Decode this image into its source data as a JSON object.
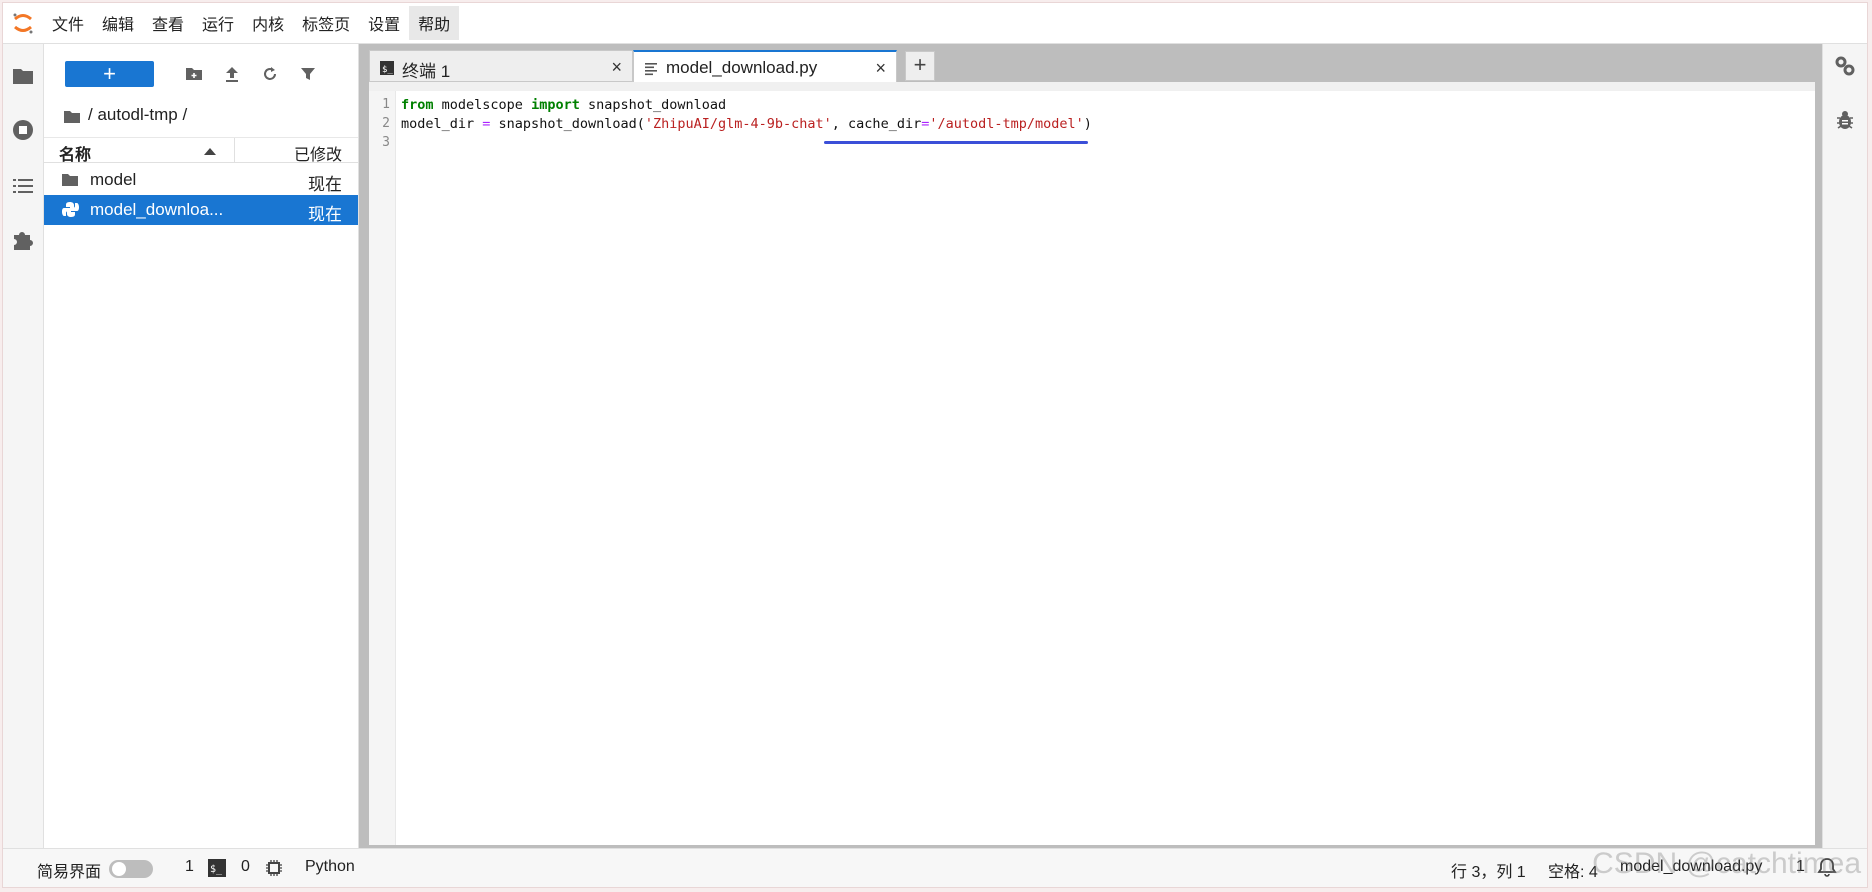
{
  "menubar": {
    "items": [
      "文件",
      "编辑",
      "查看",
      "运行",
      "内核",
      "标签页",
      "设置",
      "帮助"
    ],
    "active_index": 7
  },
  "filebrowser": {
    "new_label": "+",
    "breadcrumb": "/ autodl-tmp /",
    "col_name": "名称",
    "col_modified": "已修改",
    "items": [
      {
        "name": "model",
        "modified": "现在",
        "type": "folder"
      },
      {
        "name": "model_downloa...",
        "modified": "现在",
        "type": "python"
      }
    ]
  },
  "tabs": [
    {
      "label": "终端 1",
      "close": "×",
      "active": false
    },
    {
      "label": "model_download.py",
      "close": "×",
      "active": true
    }
  ],
  "add_tab_label": "+",
  "editor": {
    "line_numbers": [
      "1",
      "2",
      "3"
    ],
    "line1": {
      "kw1": "from",
      "mod": " modelscope ",
      "kw2": "import",
      "rest": " snapshot_download"
    },
    "line2": {
      "a": "model_dir ",
      "eq": "=",
      "b": " snapshot_download(",
      "s1": "'ZhipuAI/glm-4-9b-chat'",
      "c": ", cache_dir",
      "eq2": "=",
      "s2": "'/autodl-tmp/model'",
      "d": ")"
    }
  },
  "statusbar": {
    "simple_mode": "简易界面",
    "terminals_count": "1",
    "kernels_count": "0",
    "kernel_name": "Python",
    "cursor_pos": "行 3，列 1",
    "indent": "空格: 4",
    "filename": "model_download.py",
    "right_count": "1"
  },
  "watermark": "CSDN @catchtimea",
  "colors": {
    "accent": "#1976d2",
    "underline": "#3b4fd8",
    "logo": "#f37726"
  }
}
